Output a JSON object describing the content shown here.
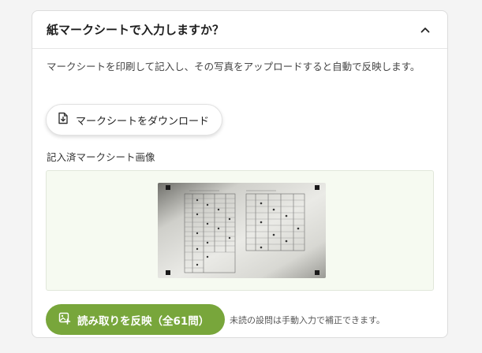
{
  "card": {
    "title": "紙マークシートで入力しますか？",
    "toggle_icon": "chevron-up-icon"
  },
  "description": "マークシートを印刷して記入し、その写真をアップロードすると自動で反映します。",
  "download_button": {
    "label": "マークシートをダウンロード",
    "icon": "download-file-icon"
  },
  "uploaded_section": {
    "label": "記入済マークシート画像"
  },
  "apply_button": {
    "label": "読み取りを反映（全61問）",
    "icon": "image-scan-icon"
  },
  "hint": "未読の設問は手動入力で補正できます。",
  "colors": {
    "accent": "#78a63b",
    "image_box_bg": "#f6faf1"
  }
}
